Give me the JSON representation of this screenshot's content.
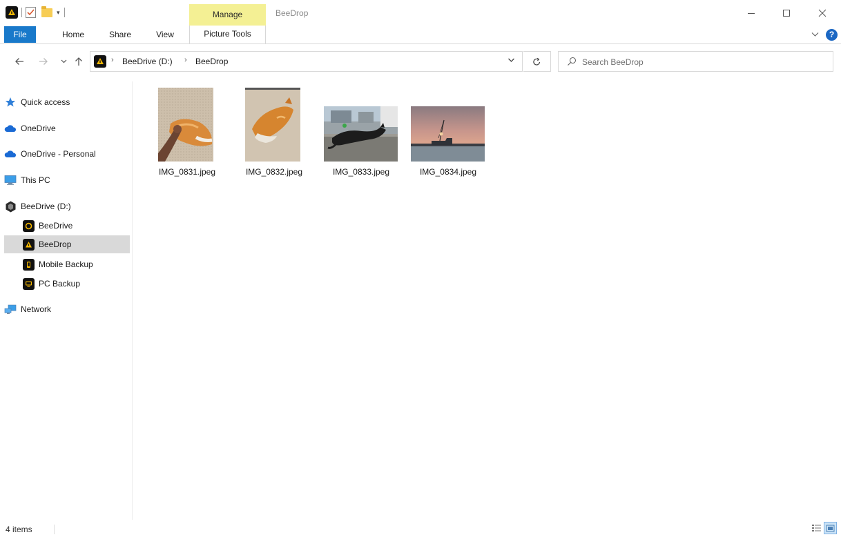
{
  "titlebar": {
    "window_title": "BeeDrop",
    "contextual_group": "Manage",
    "quick_access_toolbar": [
      "beedrop-app-icon",
      "properties-icon",
      "new-folder-icon",
      "customize-dropdown-icon"
    ]
  },
  "ribbon": {
    "tabs": {
      "file": "File",
      "home": "Home",
      "share": "Share",
      "view": "View",
      "picture_tools": "Picture Tools"
    },
    "accent": "#1979CA",
    "contextual_color": "#F4F094"
  },
  "address_bar": {
    "breadcrumbs": [
      "BeeDrive (D:)",
      "BeeDrop"
    ]
  },
  "search": {
    "placeholder": "Search BeeDrop"
  },
  "sidebar": {
    "items": [
      {
        "label": "Quick access",
        "icon": "star-icon"
      },
      {
        "label": "OneDrive",
        "icon": "cloud-icon"
      },
      {
        "label": "OneDrive - Personal",
        "icon": "cloud-icon"
      },
      {
        "label": "This PC",
        "icon": "monitor-icon"
      },
      {
        "label": "BeeDrive (D:)",
        "icon": "drive-icon"
      },
      {
        "label": "BeeDrive",
        "icon": "beedrive-icon"
      },
      {
        "label": "BeeDrop",
        "icon": "beedrop-icon",
        "selected": true
      },
      {
        "label": "Mobile Backup",
        "icon": "mobile-icon"
      },
      {
        "label": "PC Backup",
        "icon": "pc-icon"
      },
      {
        "label": "Network",
        "icon": "network-icon"
      }
    ]
  },
  "files": [
    {
      "name": "IMG_0831.jpeg",
      "orientation": "portrait"
    },
    {
      "name": "IMG_0832.jpeg",
      "orientation": "portrait"
    },
    {
      "name": "IMG_0833.jpeg",
      "orientation": "landscape"
    },
    {
      "name": "IMG_0834.jpeg",
      "orientation": "landscape"
    }
  ],
  "statusbar": {
    "item_count": "4 items",
    "active_view": "large-icons"
  }
}
